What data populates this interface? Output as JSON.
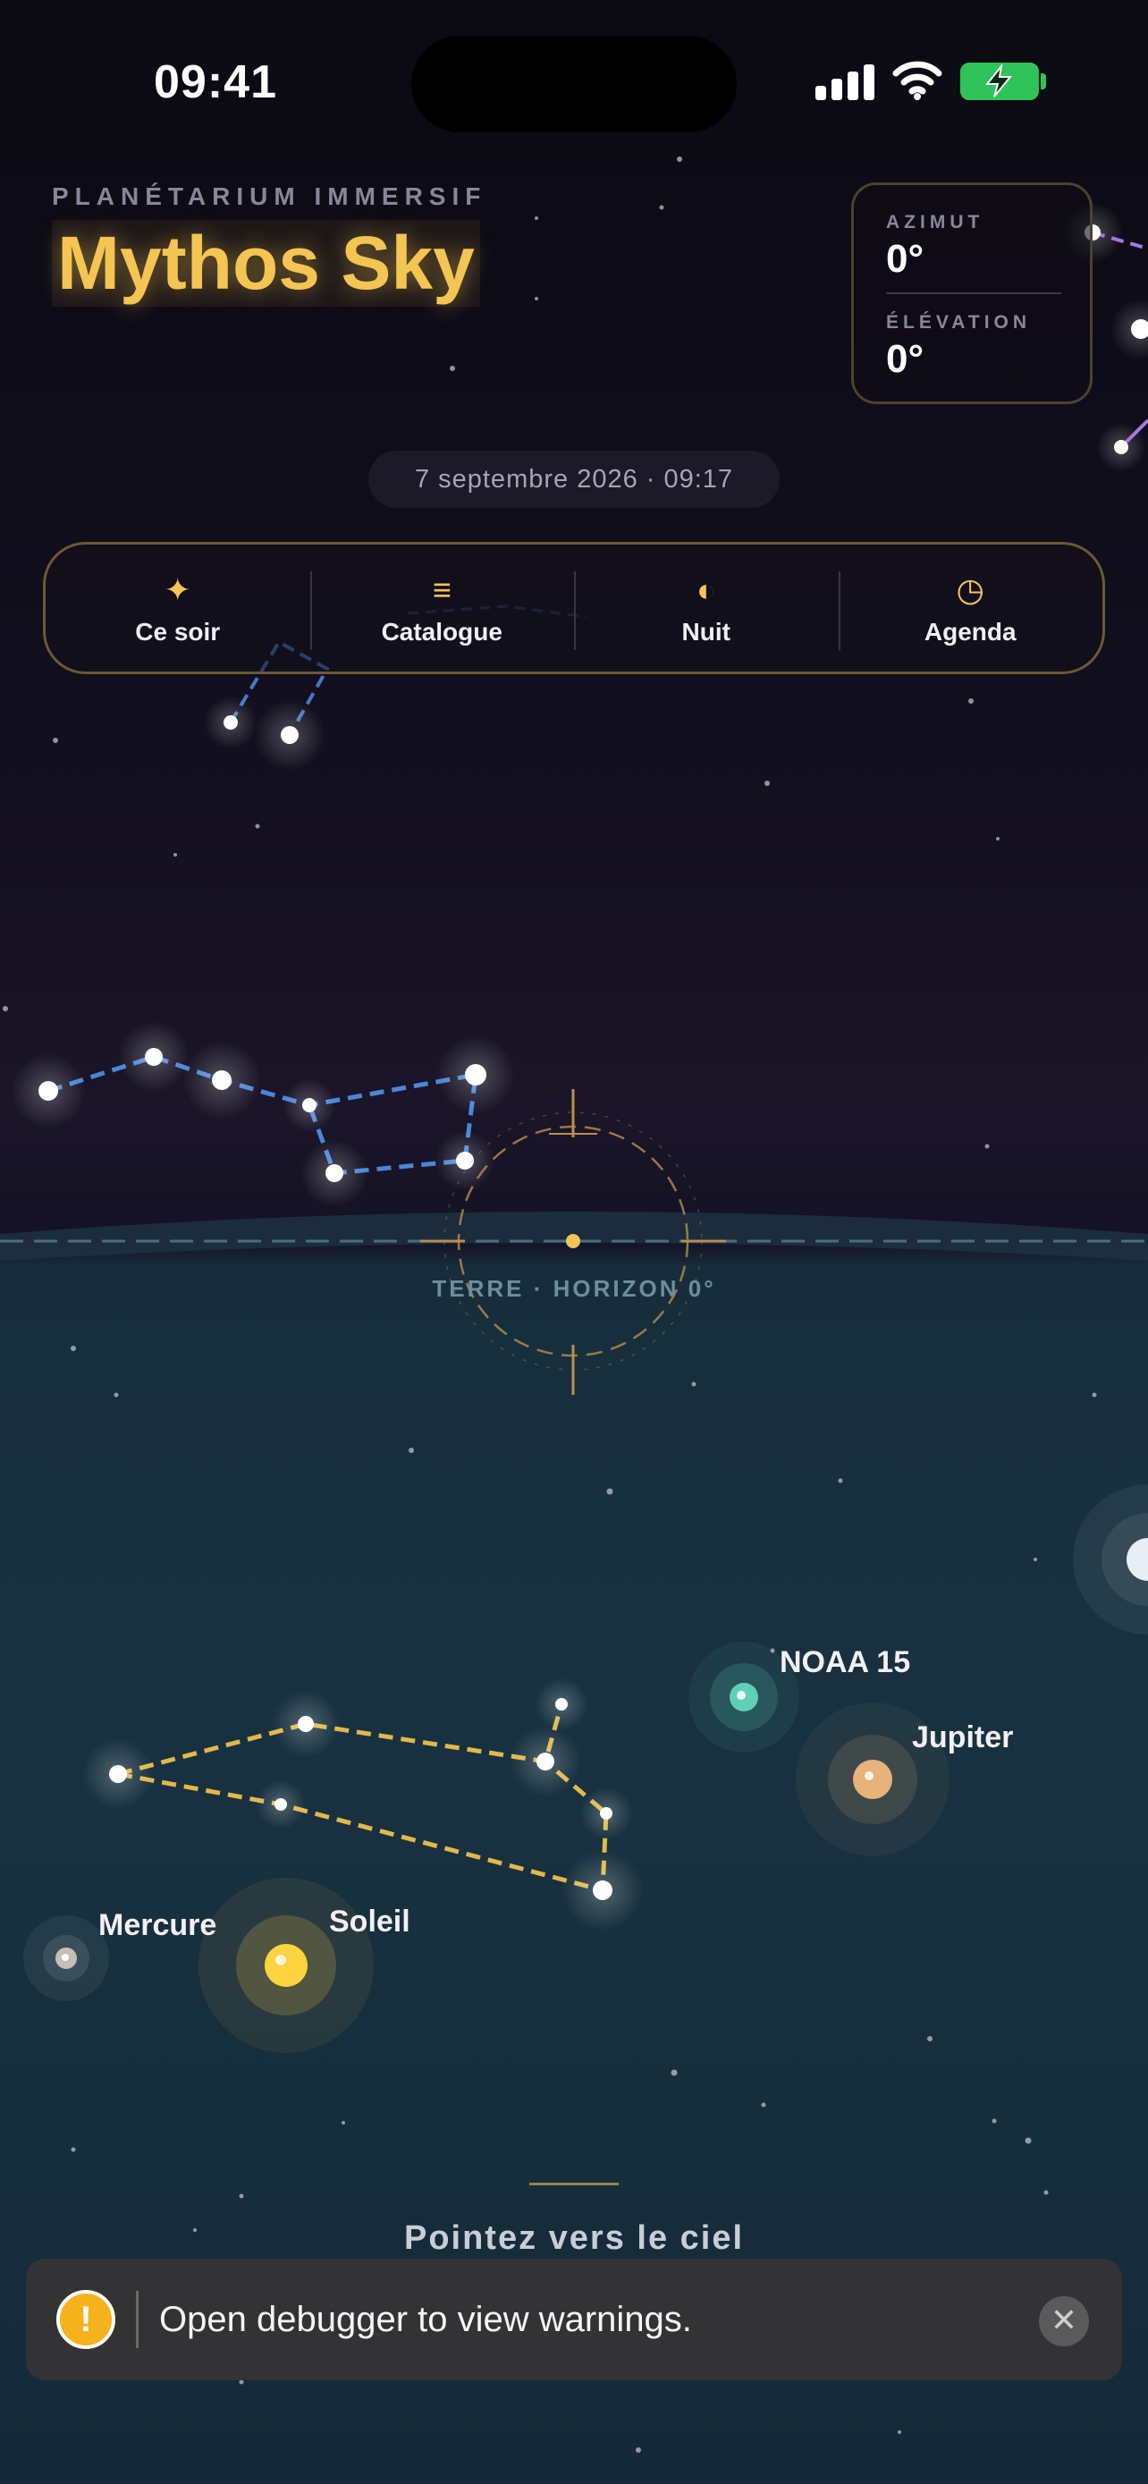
{
  "status_bar": {
    "time": "09:41"
  },
  "header": {
    "subtitle": "PLANÉTARIUM IMMERSIF",
    "title": "Mythos Sky"
  },
  "coordinates": {
    "azimuth_label": "AZIMUT",
    "azimuth_value": "0°",
    "elevation_label": "ÉLÉVATION",
    "elevation_value": "0°"
  },
  "date_time": "7 septembre 2026 · 09:17",
  "nav": {
    "items": [
      {
        "icon": "sparkle-icon",
        "glyph": "✦",
        "label": "Ce soir"
      },
      {
        "icon": "list-icon",
        "glyph": "≡",
        "label": "Catalogue"
      },
      {
        "icon": "half-moon-icon",
        "glyph": "◐",
        "label": "Nuit"
      },
      {
        "icon": "clock-icon",
        "glyph": "◷",
        "label": "Agenda"
      }
    ]
  },
  "sky": {
    "horizon_label": "TERRE · HORIZON 0°",
    "objects": {
      "satellite": "NOAA 15",
      "planet_1": "Jupiter",
      "planet_2": "Mercure",
      "star": "Soleil"
    }
  },
  "prompt": "Pointez vers le ciel",
  "toast": {
    "icon": "warning-icon",
    "message": "Open debugger to view warnings."
  },
  "colors": {
    "accent": "#f4c552",
    "constellation_blue": "#4a86d8",
    "constellation_gold": "#e2b84a",
    "satellite": "#5fcfb8"
  }
}
